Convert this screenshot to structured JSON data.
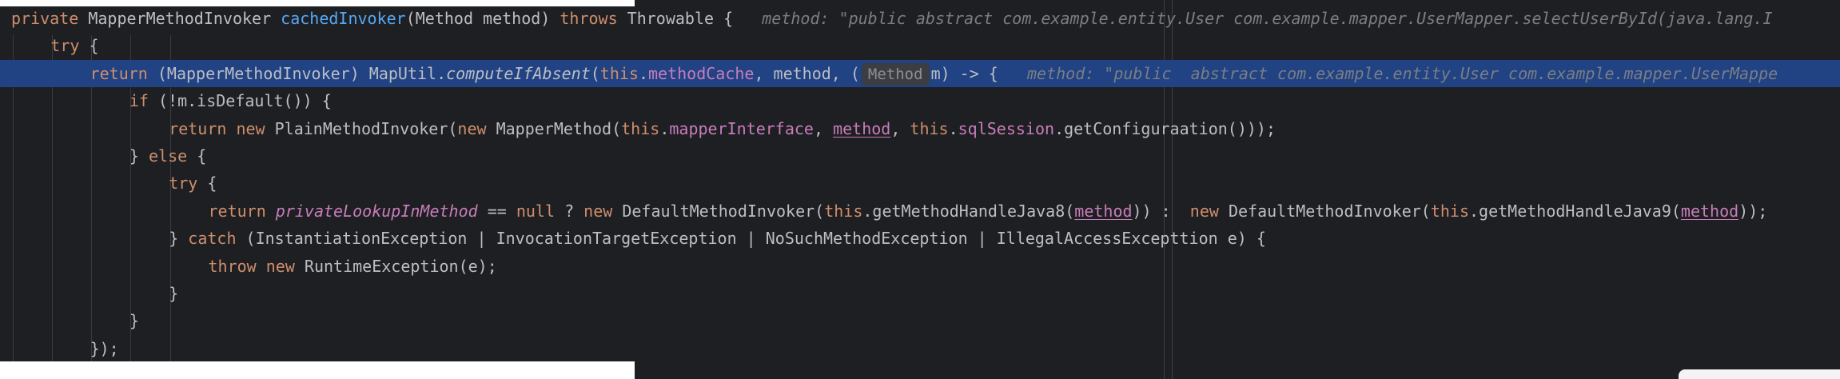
{
  "editor": {
    "lines": [
      {
        "indent": 0,
        "current": false,
        "tokens": [
          {
            "t": "private ",
            "c": "kw"
          },
          {
            "t": "MapperMethodInvoker ",
            "c": ""
          },
          {
            "t": "cachedInvoker",
            "c": "fn"
          },
          {
            "t": "(Method method) ",
            "c": ""
          },
          {
            "t": "throws ",
            "c": "kw"
          },
          {
            "t": "Throwable {",
            "c": ""
          },
          {
            "t": "   method: \"public abstract com.example.entity.User com.example.mapper.UserMapper.selectUserById(java.lang.I",
            "c": "hint-inline"
          }
        ]
      },
      {
        "indent": 1,
        "current": false,
        "tokens": [
          {
            "t": "try ",
            "c": "kw"
          },
          {
            "t": "{",
            "c": ""
          }
        ]
      },
      {
        "indent": 2,
        "current": true,
        "tokens": [
          {
            "t": "return ",
            "c": "kw"
          },
          {
            "t": "(MapperMethodInvoker) MapUtil.",
            "c": ""
          },
          {
            "t": "computeIfAbsent",
            "c": "ital"
          },
          {
            "t": "(",
            "c": ""
          },
          {
            "t": "this",
            "c": "kw"
          },
          {
            "t": ".",
            "c": ""
          },
          {
            "t": "methodCache",
            "c": "fld"
          },
          {
            "t": ", method, (",
            "c": ""
          },
          {
            "t": "Method",
            "c": "chip"
          },
          {
            "t": "m) -> {",
            "c": ""
          },
          {
            "t": "   method: \"public  abstract com.example.entity.User com.example.mapper.UserMappe",
            "c": "hint-inline"
          }
        ]
      },
      {
        "indent": 3,
        "current": false,
        "tokens": [
          {
            "t": "if ",
            "c": "kw"
          },
          {
            "t": "(!m.isDefault()) {",
            "c": ""
          }
        ]
      },
      {
        "indent": 4,
        "current": false,
        "tokens": [
          {
            "t": "return new ",
            "c": "kw"
          },
          {
            "t": "PlainMethodInvoker(",
            "c": ""
          },
          {
            "t": "new ",
            "c": "kw"
          },
          {
            "t": "MapperMethod(",
            "c": ""
          },
          {
            "t": "this",
            "c": "kw"
          },
          {
            "t": ".",
            "c": ""
          },
          {
            "t": "mapperInterface",
            "c": "fld"
          },
          {
            "t": ", ",
            "c": ""
          },
          {
            "t": "method",
            "c": "lnk"
          },
          {
            "t": ", ",
            "c": ""
          },
          {
            "t": "this",
            "c": "kw"
          },
          {
            "t": ".",
            "c": ""
          },
          {
            "t": "sqlSession",
            "c": "fld"
          },
          {
            "t": ".getConfiguraation()));",
            "c": ""
          }
        ]
      },
      {
        "indent": 3,
        "current": false,
        "tokens": [
          {
            "t": "} ",
            "c": ""
          },
          {
            "t": "else ",
            "c": "kw"
          },
          {
            "t": "{",
            "c": ""
          }
        ]
      },
      {
        "indent": 4,
        "current": false,
        "tokens": [
          {
            "t": "try ",
            "c": "kw"
          },
          {
            "t": "{",
            "c": ""
          }
        ]
      },
      {
        "indent": 5,
        "current": false,
        "tokens": [
          {
            "t": "return ",
            "c": "kw"
          },
          {
            "t": "privateLookupInMethod",
            "c": "fld ital"
          },
          {
            "t": " == ",
            "c": ""
          },
          {
            "t": "null ",
            "c": "kw"
          },
          {
            "t": "? ",
            "c": ""
          },
          {
            "t": "new ",
            "c": "kw"
          },
          {
            "t": "DefaultMethodInvoker(",
            "c": ""
          },
          {
            "t": "this",
            "c": "kw"
          },
          {
            "t": ".getMethodHandleJava8(",
            "c": ""
          },
          {
            "t": "method",
            "c": "lnk"
          },
          {
            "t": ")) :  ",
            "c": ""
          },
          {
            "t": "new ",
            "c": "kw"
          },
          {
            "t": "DefaultMethodInvoker(",
            "c": ""
          },
          {
            "t": "this",
            "c": "kw"
          },
          {
            "t": ".getMethodHandleJava9(",
            "c": ""
          },
          {
            "t": "method",
            "c": "lnk"
          },
          {
            "t": "));",
            "c": ""
          }
        ]
      },
      {
        "indent": 4,
        "current": false,
        "tokens": [
          {
            "t": "} ",
            "c": ""
          },
          {
            "t": "catch ",
            "c": "kw"
          },
          {
            "t": "(InstantiationException | InvocationTargetException | NoSuchMethodException | IllegalAccessExcepttion e) {",
            "c": ""
          }
        ]
      },
      {
        "indent": 5,
        "current": false,
        "tokens": [
          {
            "t": "throw new ",
            "c": "kw"
          },
          {
            "t": "RuntimeException(e);",
            "c": ""
          }
        ]
      },
      {
        "indent": 4,
        "current": false,
        "tokens": [
          {
            "t": "}",
            "c": ""
          }
        ]
      },
      {
        "indent": 3,
        "current": false,
        "tokens": [
          {
            "t": "}",
            "c": ""
          }
        ]
      },
      {
        "indent": 2,
        "current": false,
        "tokens": [
          {
            "t": "});",
            "c": ""
          }
        ]
      }
    ]
  },
  "colors": {
    "background": "#1e1f22",
    "current_line": "#214283",
    "keyword": "#cf8e6d",
    "function": "#56a8f5",
    "field": "#c77dbb",
    "text": "#bcbec4",
    "inline_hint": "#7a7e85"
  }
}
